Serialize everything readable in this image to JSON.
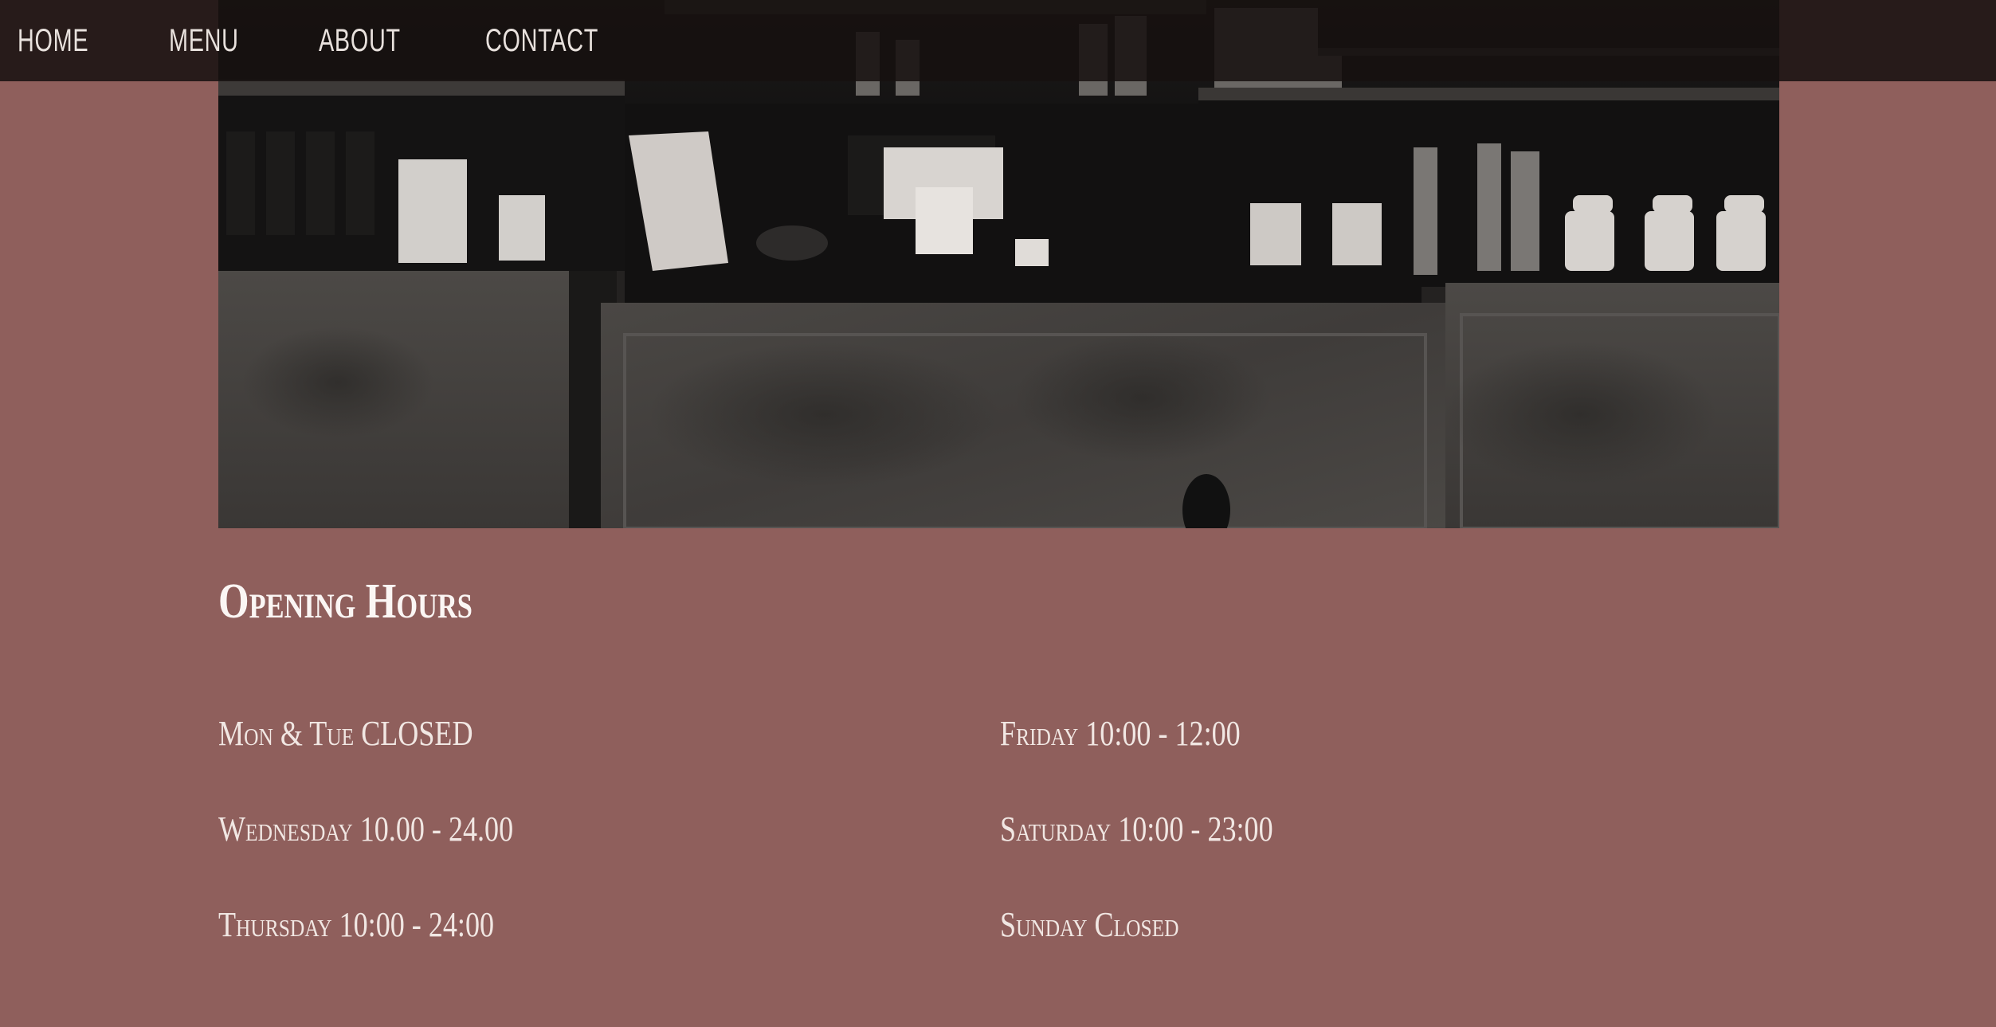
{
  "nav": {
    "items": [
      {
        "label": "HOME"
      },
      {
        "label": "MENU"
      },
      {
        "label": "ABOUT"
      },
      {
        "label": "CONTACT"
      }
    ]
  },
  "hero": {
    "image_subject": "coffee-shop-counter-photo"
  },
  "hours": {
    "title": "Opening Hours",
    "left": [
      {
        "text": "Mon & Tue CLOSED"
      },
      {
        "text": "Wednesday 10.00 - 24.00"
      },
      {
        "text": "Thursday 10:00 - 24:00"
      }
    ],
    "right": [
      {
        "text": "Friday 10:00 - 12:00"
      },
      {
        "text": "Saturday 10:00 - 23:00"
      },
      {
        "text": "Sunday Closed"
      }
    ]
  },
  "colors": {
    "page_bg": "#8f5f5c",
    "nav_bg": "#16100f",
    "text": "#f4ece8"
  }
}
